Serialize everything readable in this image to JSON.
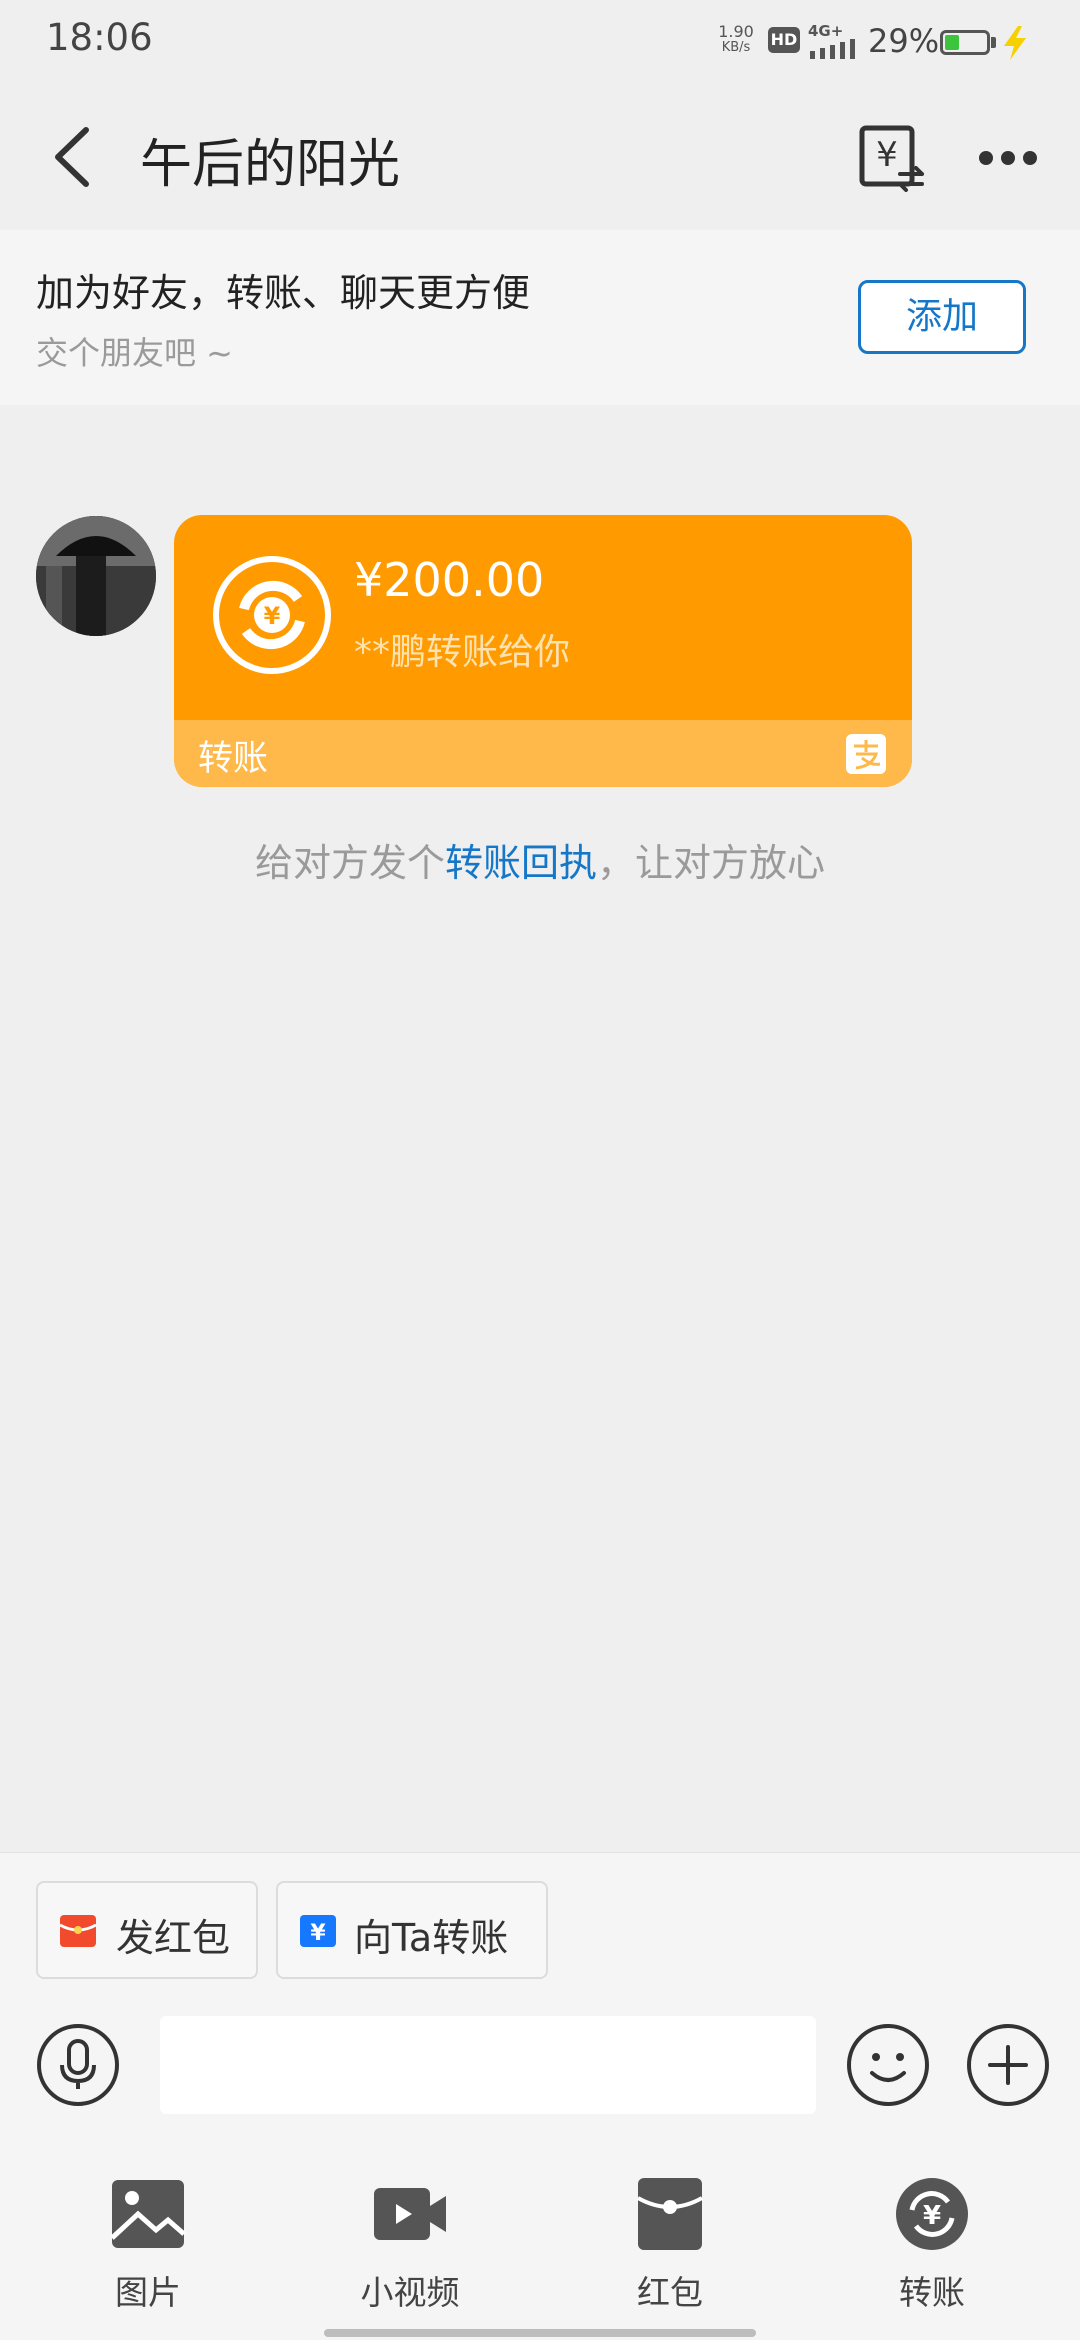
{
  "status_bar": {
    "time": "18:06",
    "net_speed_value": "1.90",
    "net_speed_unit": "KB/s",
    "hd_badge": "HD",
    "network": "4G+",
    "battery_percent": "29%"
  },
  "header": {
    "title": "午后的阳光",
    "icons": [
      "back-arrow-icon",
      "transfer-yuan-icon",
      "more-dots-icon"
    ]
  },
  "friend_banner": {
    "title": "加为好友，转账、聊天更方便",
    "subtitle": "交个朋友吧 ~",
    "add_button": "添加"
  },
  "message": {
    "amount": "¥200.00",
    "description": "**鹏转账给你",
    "footer_label": "转账",
    "accent_color": "#ff9b00"
  },
  "receipt_tip": {
    "before": "给对方发个",
    "link": "转账回执",
    "after": "，让对方放心"
  },
  "quick_actions": [
    {
      "label": "发红包",
      "icon": "red-packet-icon"
    },
    {
      "label": "向Ta转账",
      "icon": "transfer-icon"
    }
  ],
  "input": {
    "value": "",
    "placeholder": ""
  },
  "tools": [
    {
      "label": "图片",
      "icon": "image-icon"
    },
    {
      "label": "小视频",
      "icon": "video-icon"
    },
    {
      "label": "红包",
      "icon": "red-packet-icon"
    },
    {
      "label": "转账",
      "icon": "transfer-icon"
    }
  ]
}
